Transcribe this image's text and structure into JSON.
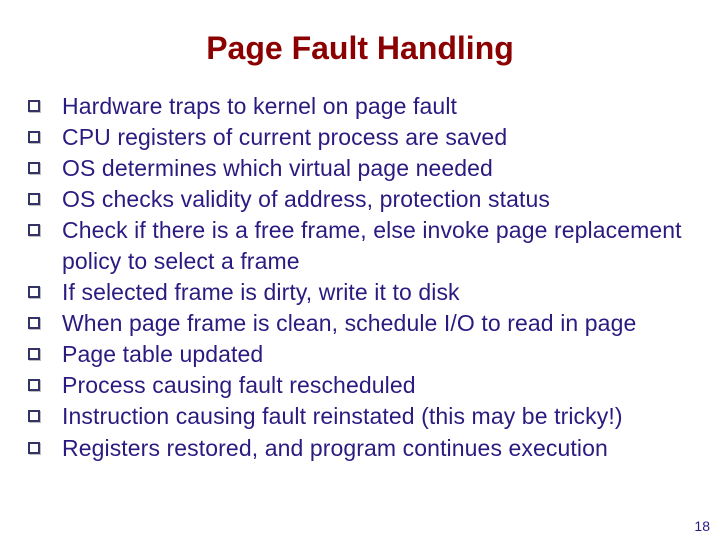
{
  "title": "Page Fault Handling",
  "bullets": {
    "b0": "Hardware traps to kernel on page fault",
    "b1": "CPU registers of current process are saved",
    "b2": "OS determines which virtual page needed",
    "b3": "OS checks validity of address, protection status",
    "b4": "Check if there is a free frame, else invoke page replacement policy to select a frame",
    "b5": "If selected frame is dirty, write it to disk",
    "b6": "When page frame is clean, schedule I/O to read in page",
    "b7": "Page table updated",
    "b8": "Process causing fault rescheduled",
    "b9": "Instruction causing fault reinstated (this may be tricky!)",
    "b10": "Registers restored, and  program continues execution"
  },
  "page_number": "18"
}
